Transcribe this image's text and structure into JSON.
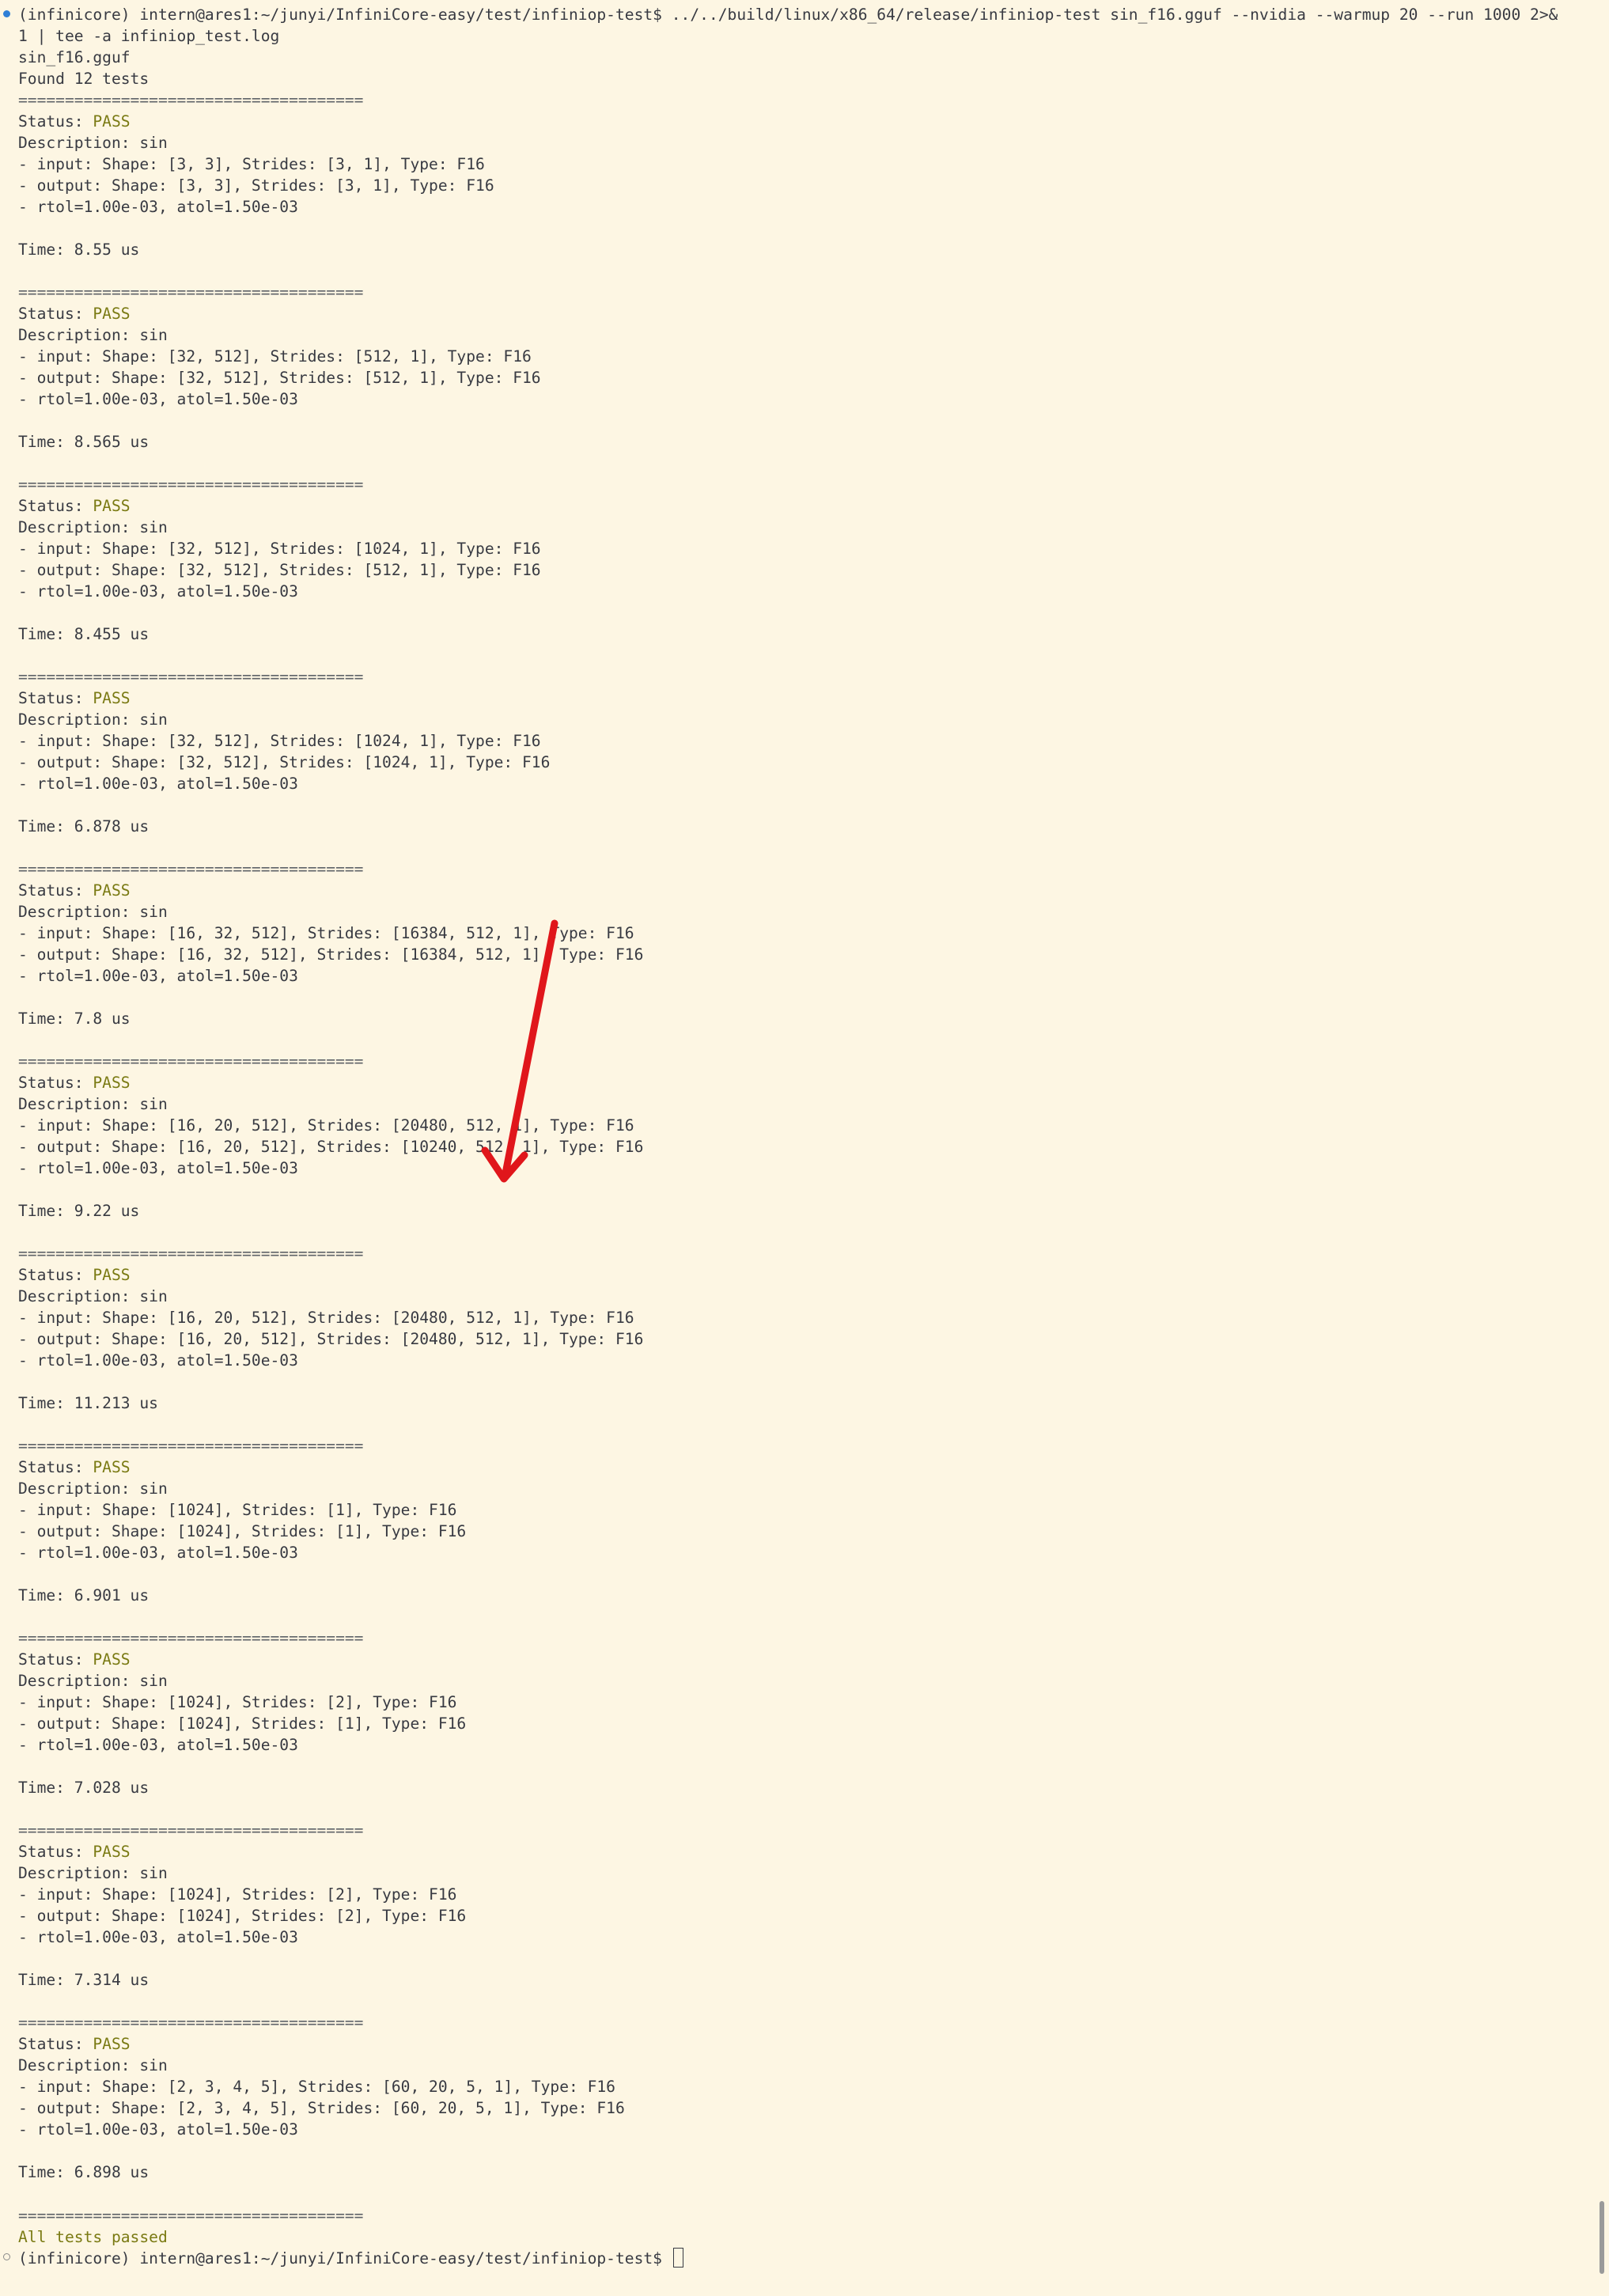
{
  "terminal": {
    "prompt": {
      "env": "(infinicore)",
      "user_host_path": "intern@ares1:~/junyi/InfiniCore-easy/test/infiniop-test$",
      "command_line1": "../../build/linux/x86_64/release/infiniop-test sin_f16.gguf --nvidia --warmup 20 --run 1000 2>&",
      "command_line2": "1 | tee -a infiniop_test.log"
    },
    "file_line": "sin_f16.gguf",
    "found_line": "Found 12 tests",
    "separator": "=====================================",
    "status_prefix": "Status: ",
    "status_value": "PASS",
    "tests": [
      {
        "description": "Description: sin",
        "input": "- input: Shape: [3, 3], Strides: [3, 1], Type: F16",
        "output": "- output: Shape: [3, 3], Strides: [3, 1], Type: F16",
        "tol": "- rtol=1.00e-03, atol=1.50e-03",
        "time": "Time: 8.55 us"
      },
      {
        "description": "Description: sin",
        "input": "- input: Shape: [32, 512], Strides: [512, 1], Type: F16",
        "output": "- output: Shape: [32, 512], Strides: [512, 1], Type: F16",
        "tol": "- rtol=1.00e-03, atol=1.50e-03",
        "time": "Time: 8.565 us"
      },
      {
        "description": "Description: sin",
        "input": "- input: Shape: [32, 512], Strides: [1024, 1], Type: F16",
        "output": "- output: Shape: [32, 512], Strides: [512, 1], Type: F16",
        "tol": "- rtol=1.00e-03, atol=1.50e-03",
        "time": "Time: 8.455 us"
      },
      {
        "description": "Description: sin",
        "input": "- input: Shape: [32, 512], Strides: [1024, 1], Type: F16",
        "output": "- output: Shape: [32, 512], Strides: [1024, 1], Type: F16",
        "tol": "- rtol=1.00e-03, atol=1.50e-03",
        "time": "Time: 6.878 us"
      },
      {
        "description": "Description: sin",
        "input": "- input: Shape: [16, 32, 512], Strides: [16384, 512, 1], Type: F16",
        "output": "- output: Shape: [16, 32, 512], Strides: [16384, 512, 1], Type: F16",
        "tol": "- rtol=1.00e-03, atol=1.50e-03",
        "time": "Time: 7.8 us"
      },
      {
        "description": "Description: sin",
        "input": "- input: Shape: [16, 20, 512], Strides: [20480, 512, 1], Type: F16",
        "output": "- output: Shape: [16, 20, 512], Strides: [10240, 512, 1], Type: F16",
        "tol": "- rtol=1.00e-03, atol=1.50e-03",
        "time": "Time: 9.22 us"
      },
      {
        "description": "Description: sin",
        "input": "- input: Shape: [16, 20, 512], Strides: [20480, 512, 1], Type: F16",
        "output": "- output: Shape: [16, 20, 512], Strides: [20480, 512, 1], Type: F16",
        "tol": "- rtol=1.00e-03, atol=1.50e-03",
        "time": "Time: 11.213 us"
      },
      {
        "description": "Description: sin",
        "input": "- input: Shape: [1024], Strides: [1], Type: F16",
        "output": "- output: Shape: [1024], Strides: [1], Type: F16",
        "tol": "- rtol=1.00e-03, atol=1.50e-03",
        "time": "Time: 6.901 us"
      },
      {
        "description": "Description: sin",
        "input": "- input: Shape: [1024], Strides: [2], Type: F16",
        "output": "- output: Shape: [1024], Strides: [1], Type: F16",
        "tol": "- rtol=1.00e-03, atol=1.50e-03",
        "time": "Time: 7.028 us"
      },
      {
        "description": "Description: sin",
        "input": "- input: Shape: [1024], Strides: [2], Type: F16",
        "output": "- output: Shape: [1024], Strides: [2], Type: F16",
        "tol": "- rtol=1.00e-03, atol=1.50e-03",
        "time": "Time: 7.314 us"
      },
      {
        "description": "Description: sin",
        "input": "- input: Shape: [2, 3, 4, 5], Strides: [60, 20, 5, 1], Type: F16",
        "output": "- output: Shape: [2, 3, 4, 5], Strides: [60, 20, 5, 1], Type: F16",
        "tol": "- rtol=1.00e-03, atol=1.50e-03",
        "time": "Time: 6.898 us"
      }
    ],
    "final_message": "All tests passed",
    "final_prompt": {
      "env": "(infinicore)",
      "user_host_path": "intern@ares1:~/junyi/InfiniCore-easy/test/infiniop-test$"
    }
  },
  "colors": {
    "background": "#fdf6e3",
    "text": "#383a42",
    "pass": "#7a7a13",
    "annotation_arrow": "#e0161b",
    "prompt_dot": "#2f7fd6"
  }
}
